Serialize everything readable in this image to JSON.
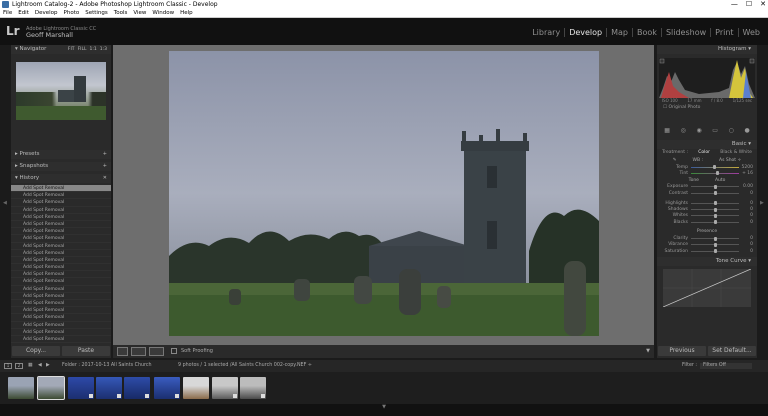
{
  "window": {
    "title": "Lightroom Catalog-2 - Adobe Photoshop Lightroom Classic - Develop",
    "minimize": "—",
    "maximize": "☐",
    "close": "✕"
  },
  "menu": [
    "File",
    "Edit",
    "Develop",
    "Photo",
    "Settings",
    "Tools",
    "View",
    "Window",
    "Help"
  ],
  "identity": {
    "logo": "Lr",
    "product": "Adobe Lightroom Classic CC",
    "user": "Geoff Marshall"
  },
  "modules": [
    "Library",
    "Develop",
    "Map",
    "Book",
    "Slideshow",
    "Print",
    "Web"
  ],
  "left": {
    "navigator": {
      "title": "Navigator",
      "zoom": [
        "FIT",
        "FILL",
        "1:1",
        "1:3"
      ]
    },
    "presets": "Presets",
    "snapshots": "Snapshots",
    "history": {
      "title": "History",
      "items": [
        "Add Spot Removal",
        "Add Spot Removal",
        "Add Spot Removal",
        "Add Spot Removal",
        "Add Spot Removal",
        "Add Spot Removal",
        "Add Spot Removal",
        "Add Spot Removal",
        "Add Spot Removal",
        "Add Spot Removal",
        "Add Spot Removal",
        "Add Spot Removal",
        "Add Spot Removal",
        "Add Spot Removal",
        "Add Spot Removal",
        "Add Spot Removal",
        "Add Spot Removal",
        "Add Spot Removal",
        "Add Spot Removal",
        "Add Spot Removal",
        "Add Spot Removal",
        "Add Spot Removal"
      ]
    },
    "copy": "Copy...",
    "paste": "Paste"
  },
  "toolbar": {
    "soft_proofing": "Soft Proofing"
  },
  "right": {
    "histogram": "Histogram",
    "readout": [
      "ISO 100",
      "17 mm",
      "f / 8.0",
      "1/125 sec"
    ],
    "original_photo": "Original Photo",
    "basic": "Basic",
    "treatment": {
      "label": "Treatment :",
      "color": "Color",
      "bw": "Black & White"
    },
    "profile": {
      "label": "WB :",
      "value": "As Shot ÷"
    },
    "temp": {
      "name": "Temp",
      "value": "5200"
    },
    "tint": {
      "name": "Tint",
      "value": "+ 16"
    },
    "tone": {
      "label": "Tone",
      "auto": "Auto"
    },
    "tone_sliders": [
      {
        "name": "Exposure",
        "value": "0.00"
      },
      {
        "name": "Contrast",
        "value": "0"
      },
      {
        "name": "Highlights",
        "value": "0"
      },
      {
        "name": "Shadows",
        "value": "0"
      },
      {
        "name": "Whites",
        "value": "0"
      },
      {
        "name": "Blacks",
        "value": "0"
      }
    ],
    "presence": "Presence",
    "presence_sliders": [
      {
        "name": "Clarity",
        "value": "0"
      },
      {
        "name": "Vibrance",
        "value": "0"
      },
      {
        "name": "Saturation",
        "value": "0"
      }
    ],
    "tone_curve": "Tone Curve",
    "previous": "Previous",
    "reset": "Set Default..."
  },
  "filmbar": {
    "pages": [
      "1",
      "2"
    ],
    "source": "Folder : 2017-10-13 All Saints Church",
    "count": "9 photos / 1 selected /All Saints Church 002-copy.NEF ÷",
    "filter_label": "Filter :",
    "filter_value": "Filters Off"
  }
}
